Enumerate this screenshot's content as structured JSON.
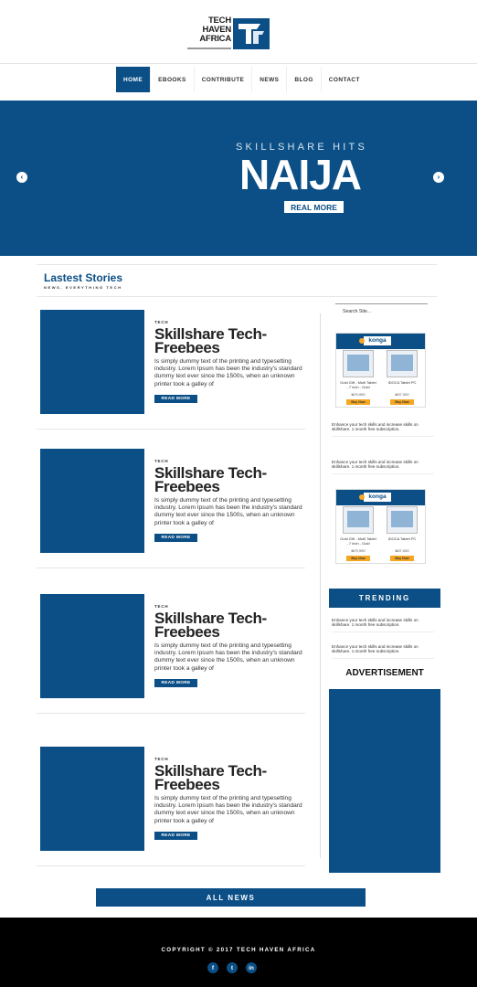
{
  "brand": {
    "logo_line1": "TECH",
    "logo_line2": "HAVEN",
    "logo_line3": "AFRICA",
    "logo_mark": "TH"
  },
  "nav": {
    "items": [
      {
        "label": "HOME",
        "active": true
      },
      {
        "label": "EBOOKS",
        "active": false
      },
      {
        "label": "CONTRIBUTE",
        "active": false
      },
      {
        "label": "NEWS",
        "active": false
      },
      {
        "label": "BLOG",
        "active": false
      },
      {
        "label": "CONTACT",
        "active": false
      }
    ]
  },
  "hero": {
    "kicker": "SKILLSHARE HITS",
    "title": "NAIJA",
    "button": "REAL MORE",
    "prev_icon": "chevron-left-icon",
    "next_icon": "chevron-right-icon",
    "prev_glyph": "‹",
    "next_glyph": "›"
  },
  "latest": {
    "title": "Lastest Stories",
    "subtitle": "NEWS, EVERYTHING TECH"
  },
  "posts": [
    {
      "category": "TECH",
      "title": "Skillshare Tech-Freebees",
      "body": "Is simply dummy text of the printing and typesetting industry. Lorem Ipsum has been the industry's standard dummy text ever since the 1500s, when an unknown printer took a galley of",
      "button": "READ MORE"
    },
    {
      "category": "TECH",
      "title": "Skillshare Tech-Freebees",
      "body": "Is simply dummy text of the printing and typesetting industry. Lorem Ipsum has been the industry's standard dummy text ever since the 1500s, when an unknown printer took a galley of",
      "button": "READ MORE"
    },
    {
      "category": "TECH",
      "title": "Skillshare Tech-Freebees",
      "body": "Is simply dummy text of the printing and typesetting industry. Lorem Ipsum has been the industry's standard dummy text ever since the 1500s, when an unknown printer took a galley of",
      "button": "READ MORE"
    },
    {
      "category": "TECH",
      "title": "Skillshare Tech-Freebees",
      "body": "Is simply dummy text of the printing and typesetting industry. Lorem Ipsum has been the industry's standard dummy text ever since the 1500s, when an unknown printer took a galley of",
      "button": "READ MORE"
    }
  ],
  "sidebar": {
    "search_placeholder": "Search Site...",
    "ads": [
      {
        "brand": "konga",
        "item_a": "Gold Gift - Multi Tablet - 7 inch - Gold",
        "item_b": "IDOCA Tablet PC",
        "price_a": "₦79,990",
        "price_b": "₦37,000",
        "buy": "Buy Now"
      },
      {
        "brand": "konga",
        "item_a": "Gold Gift - Multi Tablet - 7 inch - Gold",
        "item_b": "IDOCA Tablet PC",
        "price_a": "₦79,990",
        "price_b": "₦37,000",
        "buy": "Buy Now"
      }
    ],
    "notes": [
      "Enhance your tech skills and increase skills on skillshare. 1 month free subscription.",
      "Enhance your tech skills and increase skills on skillshare. 1 month free subscription.",
      "Enhance your tech skills and increase skills on skillshare. 1 month free subscription.",
      "Enhance your tech skills and increase skills on skillshare. 1 month free subscription."
    ],
    "trending": "TRENDING",
    "advertisement": "ADVERTISEMENT"
  },
  "all_news": "ALL NEWS",
  "footer": {
    "copyright": "COPYRIGHT © 2017 TECH HAVEN AFRICA",
    "socials": [
      {
        "icon": "facebook-icon",
        "glyph": "f"
      },
      {
        "icon": "twitter-icon",
        "glyph": "t"
      },
      {
        "icon": "linkedin-icon",
        "glyph": "in"
      }
    ]
  },
  "colors": {
    "primary": "#0b4f86",
    "accent": "#f5a623",
    "footer_bg": "#000000"
  }
}
